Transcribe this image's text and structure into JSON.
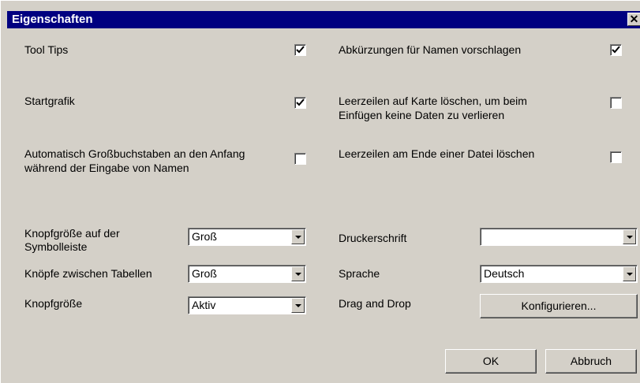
{
  "window": {
    "title": "Eigenschaften",
    "close_glyph": "✕"
  },
  "options": {
    "tool_tips": {
      "label": "Tool Tips",
      "checked": true
    },
    "abbrev": {
      "label": "Abkürzungen für Namen vorschlagen",
      "checked": true
    },
    "startgrafik": {
      "label": "Startgrafik",
      "checked": true
    },
    "leerzeilen_karte": {
      "label_line1": "Leerzeilen auf Karte löschen, um beim",
      "label_line2": "Einfügen keine Daten zu verlieren",
      "checked": false
    },
    "auto_caps": {
      "label_line1": "Automatisch Großbuchstaben an den Anfang",
      "label_line2": "während der Eingabe von Namen",
      "checked": false
    },
    "leerzeilen_ende": {
      "label": "Leerzeilen am Ende einer Datei löschen",
      "checked": false
    }
  },
  "settings": {
    "knopfgroesse_symbolleiste": {
      "label_line1": "Knopfgröße auf der",
      "label_line2": "Symbolleiste",
      "value": "Groß"
    },
    "knoepfe_tabellen": {
      "label": "Knöpfe zwischen Tabellen",
      "value": "Groß"
    },
    "knopfgroesse": {
      "label": "Knopfgröße",
      "value": "Aktiv"
    },
    "druckerschrift": {
      "label": "Druckerschrift",
      "value": ""
    },
    "sprache": {
      "label": "Sprache",
      "value": "Deutsch"
    },
    "drag_drop": {
      "label": "Drag and Drop",
      "button": "Konfigurieren..."
    }
  },
  "buttons": {
    "ok": "OK",
    "cancel": "Abbruch"
  }
}
